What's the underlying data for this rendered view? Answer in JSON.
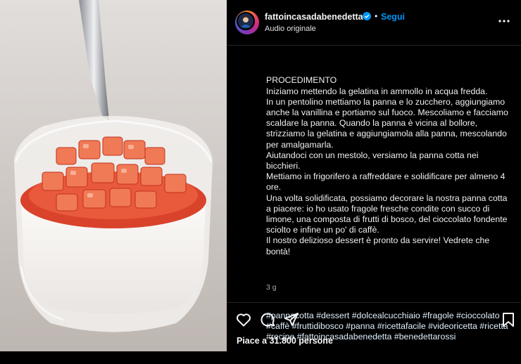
{
  "post": {
    "username": "fattoincasadabenedetta",
    "separator": "•",
    "follow_label": "Segui",
    "audio": "Audio originale",
    "caption": "PROCEDIMENTO\nIniziamo mettendo la gelatina in ammollo in acqua fredda.\nIn un pentolino mettiamo la panna e lo zucchero, aggiungiamo anche la vanillina e portiamo sul fuoco. Mescoliamo e facciamo scaldare la panna. Quando la panna è vicina al bollore, strizziamo la gelatina e aggiungiamola alla panna, mescolando per amalgamarla.\nAiutandoci con un mestolo, versiamo la panna cotta nei bicchieri.\nMettiamo in frigorifero a raffreddare e solidificare per almeno 4 ore.\nUna volta solidificata, possiamo decorare la nostra panna cotta a piacere: io ho usato fragole fresche condite con succo di limone, una composta di frutti di bosco, del cioccolato fondente sciolto e infine un po' di caffè.\nIl nostro delizioso dessert è pronto da servire! Vedrete che bontà!",
    "hashtags": "#pannacotta #dessert #dolcealcucchiaio #fragole #cioccolato #caffè #fruttidibosco #panna #ricettafacile #videoricetta #ricetta #recipe #fattoincasadabenedetta #benedettarossi",
    "age": "3 g",
    "likes": "Piace a 31.800 persone"
  },
  "icons": {
    "verified": "verified-badge-icon",
    "more": "more-options-icon",
    "like": "heart-icon",
    "comment": "comment-icon",
    "share": "share-icon",
    "save": "bookmark-icon"
  },
  "colors": {
    "accent": "#0095f6",
    "background": "#000000",
    "text": "#f5f5f5",
    "muted": "#a8a8a8"
  }
}
